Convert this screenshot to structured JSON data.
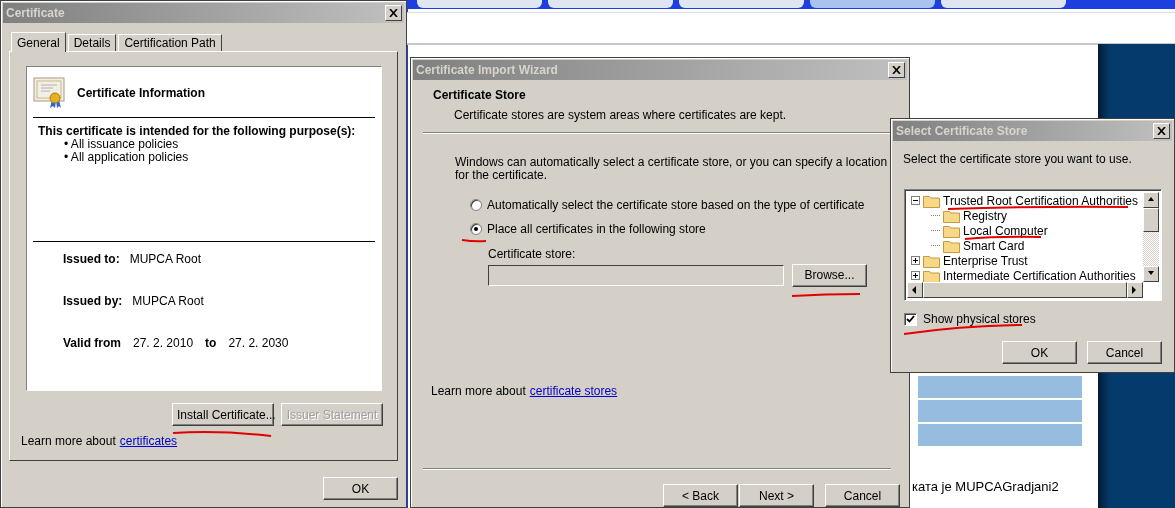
{
  "certificate_window": {
    "title": "Certificate",
    "tabs": [
      {
        "label": "General",
        "selected": true
      },
      {
        "label": "Details",
        "selected": false
      },
      {
        "label": "Certification Path",
        "selected": false
      }
    ],
    "info_title": "Certificate Information",
    "purpose_heading": "This certificate is intended for the following purpose(s):",
    "purposes": [
      "• All issuance policies",
      "• All application policies"
    ],
    "fields": [
      {
        "label": "Issued to:",
        "value": "MUPCA Root"
      },
      {
        "label": "Issued by:",
        "value": "MUPCA Root"
      }
    ],
    "validity": {
      "label": "Valid from",
      "from": "27. 2. 2010",
      "to_label": "to",
      "to": "27. 2. 2030"
    },
    "buttons": [
      {
        "label": "Install Certificate...",
        "disabled": false
      },
      {
        "label": "Issuer Statement",
        "disabled": true
      }
    ],
    "learn_more": {
      "text": "Learn more about",
      "link": "certificates"
    },
    "ok": "OK"
  },
  "import_wizard": {
    "title": "Certificate Import Wizard",
    "heading": "Certificate Store",
    "subheading": "Certificate stores are system areas where certificates are kept.",
    "description": "Windows can automatically select a certificate store, or you can specify a location for the certificate.",
    "options": [
      {
        "label": "Automatically select the certificate store based on the type of certificate",
        "selected": false
      },
      {
        "label": "Place all certificates in the following store",
        "selected": true
      }
    ],
    "store_label": "Certificate store:",
    "browse": "Browse...",
    "learn_more": {
      "text": "Learn more about",
      "link": "certificate stores"
    },
    "buttons": [
      "< Back",
      "Next >",
      "Cancel"
    ]
  },
  "select_store": {
    "title": "Select Certificate Store",
    "prompt": "Select the certificate store you want to use.",
    "tree": [
      {
        "label": "Trusted Root Certification Authorities",
        "expanded": true,
        "children": [
          {
            "label": "Registry"
          },
          {
            "label": "Local Computer"
          },
          {
            "label": "Smart Card"
          }
        ]
      },
      {
        "label": "Enterprise Trust",
        "expanded": false
      },
      {
        "label": "Intermediate Certification Authorities",
        "expanded": false
      }
    ],
    "show_physical": {
      "label": "Show physical stores",
      "checked": true
    },
    "buttons": [
      "OK",
      "Cancel"
    ]
  },
  "browser": {
    "page_text": "ката је MUPCAGradjani2"
  }
}
